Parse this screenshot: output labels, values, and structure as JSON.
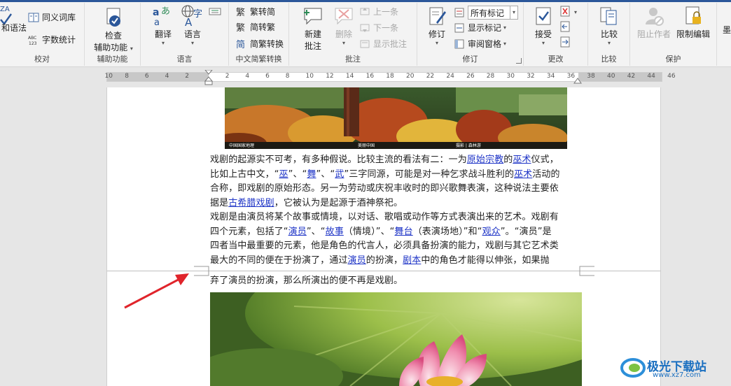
{
  "ribbon": {
    "proofing": {
      "grammar": "和语法",
      "thesaurus": "同义词库",
      "wordcount": "字数统计",
      "label": "校对"
    },
    "accessibility": {
      "check_line1": "检查",
      "check_line2": "辅助功能",
      "label": "辅助功能"
    },
    "language": {
      "translate": "翻译",
      "language": "语言",
      "label": "语言"
    },
    "chinese": {
      "to_simplified": "繁转简",
      "to_traditional": "简转繁",
      "convert": "简繁转换",
      "label": "中文简繁转换"
    },
    "comments": {
      "new_line1": "新建",
      "new_line2": "批注",
      "delete": "删除",
      "prev": "上一条",
      "next": "下一条",
      "show": "显示批注",
      "label": "批注"
    },
    "tracking": {
      "track": "修订",
      "markup_select": "所有标记",
      "show_markup": "显示标记",
      "review_pane": "审阅窗格",
      "label": "修订"
    },
    "changes": {
      "accept": "接受",
      "label": "更改"
    },
    "compare": {
      "compare": "比较",
      "label": "比较"
    },
    "protect": {
      "block_authors": "阻止作者",
      "restrict": "限制编辑",
      "label": "保护"
    },
    "more_edge": "墨"
  },
  "ruler": {
    "left_numbers": [
      "10",
      "8",
      "6",
      "4",
      "2"
    ],
    "mid_numbers": [
      "2",
      "4",
      "6",
      "8",
      "10",
      "12",
      "14",
      "16",
      "18",
      "20",
      "22",
      "24",
      "26",
      "28",
      "30",
      "32",
      "34",
      "36",
      "38"
    ],
    "right_numbers": [
      "40",
      "42",
      "44",
      "46"
    ]
  },
  "document": {
    "image1_watermark_left": "中国国家地理",
    "image1_watermark_mid": "美丽中国",
    "image1_watermark_right": "摄影 | 森林游",
    "para1": {
      "l1": [
        "戏剧的起源实不可考，有多种假说。比较主流的看法有二：一为",
        "原始宗教",
        "的",
        "巫术",
        "仪式，"
      ],
      "l2": [
        "比如上古中文，“",
        "巫",
        "”、“",
        "舞",
        "”、“",
        "武",
        "”三字同源，可能是对一种乞求战斗胜利的",
        "巫术",
        "活动的"
      ],
      "l3": "合称，即戏剧的原始形态。另一为劳动或庆祝丰收时的即兴歌舞表演，这种说法主要依",
      "l4": [
        "据是",
        "古希腊戏剧",
        "，它被认为是起源于酒神祭祀。"
      ]
    },
    "para2": {
      "l1": "戏剧是由演员将某个故事或情境，以对话、歌唱或动作等方式表演出来的艺术。戏剧有",
      "l2": [
        "四个元素，包括了“",
        "演员",
        "”、“",
        "故事",
        "（情境）”、“",
        "舞台",
        "（表演场地）”和“",
        "观众",
        "”。“演员”是"
      ],
      "l3": "四者当中最重要的元素，他是角色的代言人，必须具备扮演的能力，戏剧与其它艺术类",
      "l4": [
        "最大的不同的便在于扮演了，通过",
        "演员",
        "的扮演，",
        "剧本",
        "中的角色才能得以伸张，如果抛"
      ],
      "l5": "弃了演员的扮演，那么所演出的便不再是戏剧。"
    }
  },
  "watermark": {
    "brand": "极光下载站",
    "url": "www.xz7.com"
  },
  "colors": {
    "accent": "#2b579a",
    "link": "#1f35c7",
    "arrow": "#e0242b"
  }
}
